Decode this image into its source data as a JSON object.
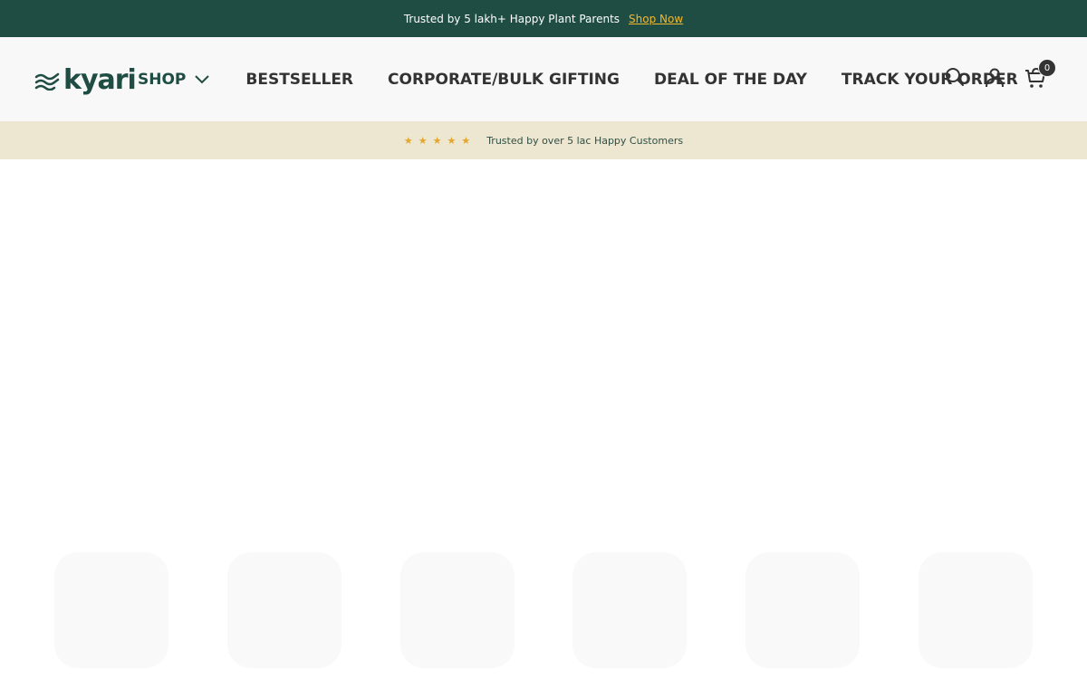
{
  "announcement": {
    "text": "Trusted by 5 lakh+ Happy Plant Parents",
    "link": "Shop Now",
    "bg": "#1f4d43",
    "link_color": "#f2b92f"
  },
  "header": {
    "logo_text": "kyari",
    "nav": [
      {
        "label": "SHOP",
        "has_dropdown": true
      },
      {
        "label": "BESTSELLER"
      },
      {
        "label": "CORPORATE/BULK GIFTING"
      },
      {
        "label": "DEAL OF THE DAY"
      },
      {
        "label": "TRACK YOUR ORDER"
      }
    ],
    "icons": [
      "search-icon",
      "account-icon",
      "cart-icon"
    ],
    "cart_count": "0"
  },
  "trust_bar": {
    "stars": "★★★★★",
    "text": "Trusted by over 5 lac Happy Customers",
    "bg": "#ede7d1",
    "star_color": "#e4a52c"
  },
  "placeholders": {
    "count": 6
  }
}
